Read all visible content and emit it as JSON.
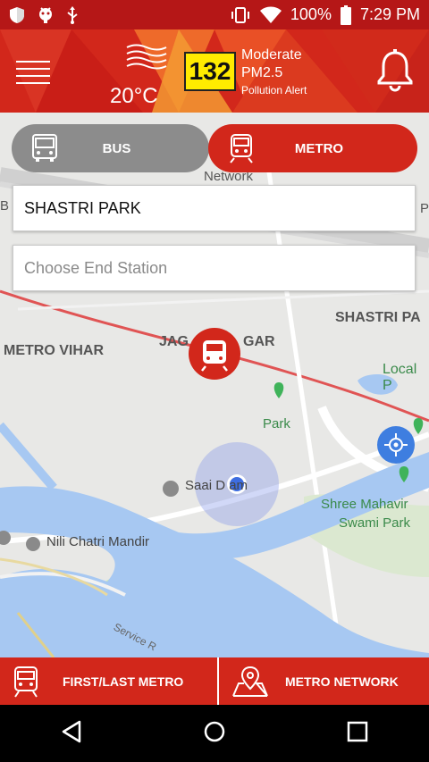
{
  "status_bar": {
    "battery_percent": "100%",
    "time": "7:29 PM",
    "icons": [
      "shield-icon",
      "android-icon",
      "usb-icon",
      "vibrate-icon",
      "wifi-icon",
      "battery-icon"
    ]
  },
  "header": {
    "temperature": "20°C",
    "aqi_value": "132",
    "aqi_level": "Moderate",
    "aqi_pollutant": "PM2.5",
    "alert_label": "Pollution Alert",
    "icons": [
      "menu-icon",
      "wind-icon",
      "bell-icon"
    ]
  },
  "mode_toggle": {
    "bus_label": "BUS",
    "metro_label": "METRO",
    "selected": "METRO"
  },
  "route": {
    "start_value": "SHASTRI PARK",
    "end_placeholder": "Choose End Station"
  },
  "map": {
    "labels": {
      "network": "Network",
      "metro_vihar": "METRO VIHAR",
      "jag_gar_left": "JAG",
      "jag_gar_right": "GAR",
      "shastri_park": "SHASTRI PA",
      "local_park": "Local P",
      "park": "Park",
      "saai_dham": "Saai D   am",
      "shree_mahavir": "Shree Mahavir",
      "swami_park": "Swami Park",
      "nili_chatri": "Nili Chatri Mandir",
      "service_road": "Service R",
      "edge_b": "B",
      "edge_p": "P"
    },
    "colors": {
      "river": "#a7c8f2",
      "park": "#c9e7b8",
      "metro_line": "#e05454",
      "accent": "#d2271b"
    }
  },
  "bottom_bar": {
    "first_last_label": "FIRST/LAST METRO",
    "network_label": "METRO NETWORK"
  },
  "nav_bar": {
    "icons": [
      "back-icon",
      "home-icon",
      "recents-icon"
    ]
  }
}
